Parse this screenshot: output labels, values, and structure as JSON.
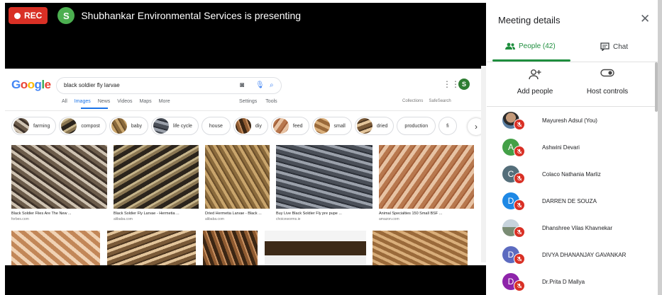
{
  "meeting": {
    "rec_label": "REC",
    "presenter_initial": "S",
    "presenting_text": "Shubhankar Environmental Services is presenting"
  },
  "browser": {
    "search_query": "black soldier fly larvae",
    "tabs": [
      "All",
      "Images",
      "News",
      "Videos",
      "Maps",
      "More"
    ],
    "tools": [
      "Settings",
      "Tools"
    ],
    "right": [
      "Collections",
      "SafeSearch"
    ],
    "account_initial": "S",
    "chips": [
      "farming",
      "compost",
      "baby",
      "life cycle",
      "house",
      "diy",
      "feed",
      "small",
      "dried",
      "production",
      "fi"
    ],
    "results": [
      {
        "caption": "Black Soldier Flies Are The New ...",
        "source": "forbes.com"
      },
      {
        "caption": "Black Soldier Fly Larvae - Hermetia ...",
        "source": "alibaba.com"
      },
      {
        "caption": "Dried Hermetia Larvae - Black ...",
        "source": "alibaba.com"
      },
      {
        "caption": "Buy Live Black Soldier Fly pre pupe ...",
        "source": "choiceworms.ie"
      },
      {
        "caption": "Animal Specialties 150 Small BSF ...",
        "source": "amazon.com"
      }
    ]
  },
  "panel": {
    "title": "Meeting details",
    "tab_people": "People (42)",
    "tab_chat": "Chat",
    "add_people": "Add people",
    "host_controls": "Host controls",
    "participants": [
      {
        "name": "Mayuresh Adsul (You)",
        "initial": "",
        "color": "#8d6e63"
      },
      {
        "name": "Ashwini Devari",
        "initial": "A",
        "color": "#43a047"
      },
      {
        "name": "Colaco Nathania Marliz",
        "initial": "C",
        "color": "#546e7a"
      },
      {
        "name": "DARREN DE SOUZA",
        "initial": "D",
        "color": "#1e88e5"
      },
      {
        "name": "Dhanshree Vilas Khavnekar",
        "initial": "",
        "color": "#90a4ae"
      },
      {
        "name": "DIVYA DHANANJAY GAVANKAR",
        "initial": "D",
        "color": "#5c6bc0"
      },
      {
        "name": "Dr.Prita D Mallya",
        "initial": "D",
        "color": "#8e24aa"
      }
    ]
  }
}
